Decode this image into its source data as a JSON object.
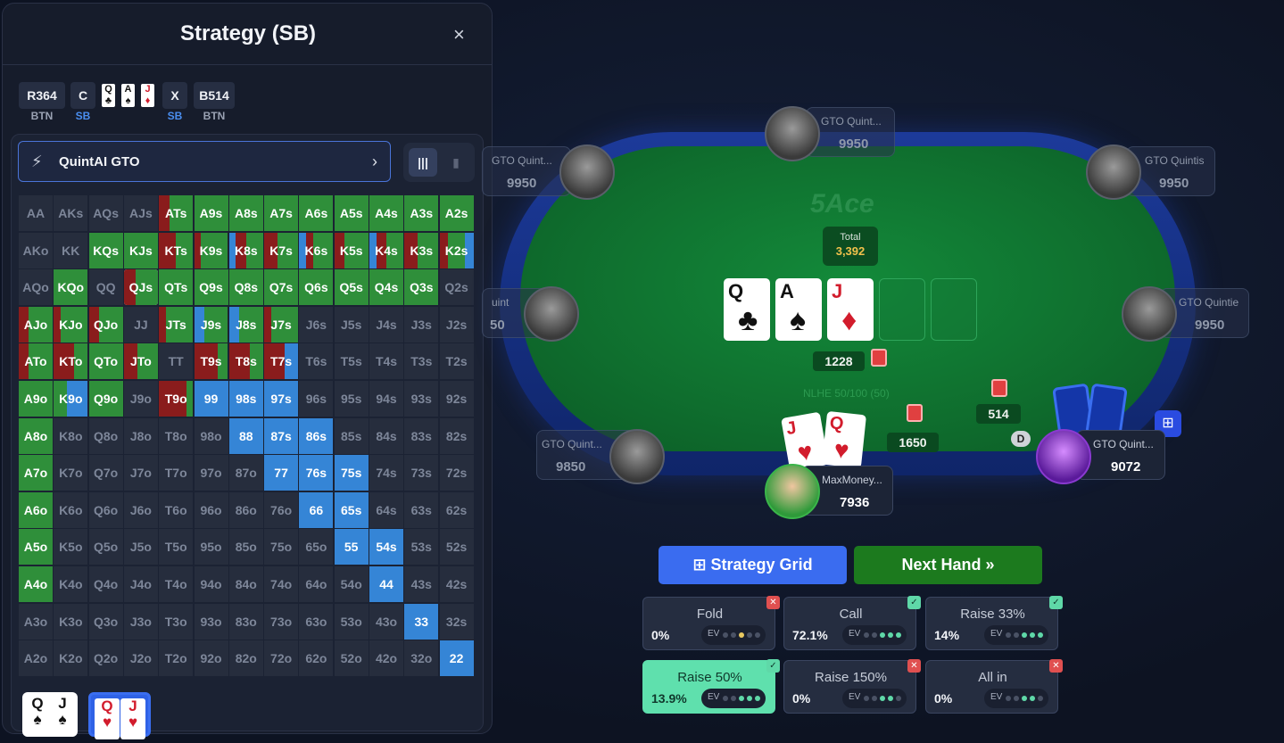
{
  "panel": {
    "title": "Strategy (SB)",
    "close": "×",
    "actions": [
      {
        "label": "R364",
        "sub": "BTN",
        "subColor": "#9aa2b3"
      },
      {
        "label": "C",
        "sub": "SB",
        "subColor": "#4a8ef0"
      },
      {
        "label": "X",
        "sub": "SB",
        "subColor": "#4a8ef0"
      },
      {
        "label": "B514",
        "sub": "BTN",
        "subColor": "#9aa2b3"
      }
    ],
    "history_cards": [
      {
        "rank": "Q",
        "suit": "♣",
        "color": "#111111"
      },
      {
        "rank": "A",
        "suit": "♠",
        "color": "#111111"
      },
      {
        "rank": "J",
        "suit": "♦",
        "color": "#d21c2c"
      }
    ],
    "engine": {
      "name": "QuintAI GTO",
      "bolt": "⚡",
      "chevron": "›"
    },
    "view_toggle": {
      "grid_icon": "|||",
      "bars_icon": "▮"
    },
    "combos": [
      {
        "r1": "Q",
        "s1": "♠",
        "r2": "J",
        "s2": "♠",
        "color": "#111111"
      },
      {
        "r1": "Q",
        "s1": "♥",
        "r2": "J",
        "s2": "♥",
        "color": "#d21c2c"
      }
    ]
  },
  "matrix": {
    "rows": [
      [
        "AA",
        "AKs",
        "AQs",
        "AJs",
        "ATs",
        "A9s",
        "A8s",
        "A7s",
        "A6s",
        "A5s",
        "A4s",
        "A3s",
        "A2s"
      ],
      [
        "AKo",
        "KK",
        "KQs",
        "KJs",
        "KTs",
        "K9s",
        "K8s",
        "K7s",
        "K6s",
        "K5s",
        "K4s",
        "K3s",
        "K2s"
      ],
      [
        "AQo",
        "KQo",
        "QQ",
        "QJs",
        "QTs",
        "Q9s",
        "Q8s",
        "Q7s",
        "Q6s",
        "Q5s",
        "Q4s",
        "Q3s",
        "Q2s"
      ],
      [
        "AJo",
        "KJo",
        "QJo",
        "JJ",
        "JTs",
        "J9s",
        "J8s",
        "J7s",
        "J6s",
        "J5s",
        "J4s",
        "J3s",
        "J2s"
      ],
      [
        "ATo",
        "KTo",
        "QTo",
        "JTo",
        "TT",
        "T9s",
        "T8s",
        "T7s",
        "T6s",
        "T5s",
        "T4s",
        "T3s",
        "T2s"
      ],
      [
        "A9o",
        "K9o",
        "Q9o",
        "J9o",
        "T9o",
        "99",
        "98s",
        "97s",
        "96s",
        "95s",
        "94s",
        "93s",
        "92s"
      ],
      [
        "A8o",
        "K8o",
        "Q8o",
        "J8o",
        "T8o",
        "98o",
        "88",
        "87s",
        "86s",
        "85s",
        "84s",
        "83s",
        "82s"
      ],
      [
        "A7o",
        "K7o",
        "Q7o",
        "J7o",
        "T7o",
        "97o",
        "87o",
        "77",
        "76s",
        "75s",
        "74s",
        "73s",
        "72s"
      ],
      [
        "A6o",
        "K6o",
        "Q6o",
        "J6o",
        "T6o",
        "96o",
        "86o",
        "76o",
        "66",
        "65s",
        "64s",
        "63s",
        "62s"
      ],
      [
        "A5o",
        "K5o",
        "Q5o",
        "J5o",
        "T5o",
        "95o",
        "85o",
        "75o",
        "65o",
        "55",
        "54s",
        "53s",
        "52s"
      ],
      [
        "A4o",
        "K4o",
        "Q4o",
        "J4o",
        "T4o",
        "94o",
        "84o",
        "74o",
        "64o",
        "54o",
        "44",
        "43s",
        "42s"
      ],
      [
        "A3o",
        "K3o",
        "Q3o",
        "J3o",
        "T3o",
        "93o",
        "83o",
        "73o",
        "63o",
        "53o",
        "43o",
        "33",
        "32s"
      ],
      [
        "A2o",
        "K2o",
        "Q2o",
        "J2o",
        "T2o",
        "92o",
        "82o",
        "72o",
        "62o",
        "52o",
        "42o",
        "32o",
        "22"
      ]
    ],
    "colors": {
      "green": "#2f8f3a",
      "red": "#8a1c1c",
      "blue": "#3585d6",
      "empty": "#262d3d"
    },
    "fills": {
      "ATs": [
        [
          "red",
          0.3
        ],
        [
          "green",
          0.7
        ]
      ],
      "A9s": [
        [
          "green",
          1
        ]
      ],
      "A8s": [
        [
          "green",
          1
        ]
      ],
      "A7s": [
        [
          "green",
          1
        ]
      ],
      "A6s": [
        [
          "green",
          1
        ]
      ],
      "A5s": [
        [
          "green",
          1
        ]
      ],
      "A4s": [
        [
          "green",
          1
        ]
      ],
      "A3s": [
        [
          "green",
          1
        ]
      ],
      "A2s": [
        [
          "green",
          1
        ]
      ],
      "KQs": [
        [
          "green",
          1
        ]
      ],
      "KJs": [
        [
          "green",
          1
        ]
      ],
      "KTs": [
        [
          "red",
          0.5
        ],
        [
          "green",
          0.5
        ]
      ],
      "K9s": [
        [
          "red",
          0.2
        ],
        [
          "green",
          0.8
        ]
      ],
      "K8s": [
        [
          "blue",
          0.2
        ],
        [
          "red",
          0.3
        ],
        [
          "green",
          0.5
        ]
      ],
      "K7s": [
        [
          "red",
          0.4
        ],
        [
          "green",
          0.6
        ]
      ],
      "K6s": [
        [
          "blue",
          0.2
        ],
        [
          "red",
          0.2
        ],
        [
          "green",
          0.6
        ]
      ],
      "K5s": [
        [
          "red",
          0.3
        ],
        [
          "green",
          0.7
        ]
      ],
      "K4s": [
        [
          "blue",
          0.2
        ],
        [
          "red",
          0.3
        ],
        [
          "green",
          0.5
        ]
      ],
      "K3s": [
        [
          "red",
          0.4
        ],
        [
          "green",
          0.6
        ]
      ],
      "K2s": [
        [
          "red",
          0.25
        ],
        [
          "green",
          0.5
        ],
        [
          "blue",
          0.25
        ]
      ],
      "KQo": [
        [
          "green",
          1
        ]
      ],
      "QJs": [
        [
          "red",
          0.35
        ],
        [
          "green",
          0.65
        ]
      ],
      "QTs": [
        [
          "green",
          1
        ]
      ],
      "Q9s": [
        [
          "green",
          1
        ]
      ],
      "Q8s": [
        [
          "green",
          1
        ]
      ],
      "Q7s": [
        [
          "green",
          1
        ]
      ],
      "Q6s": [
        [
          "green",
          1
        ]
      ],
      "Q5s": [
        [
          "green",
          1
        ]
      ],
      "Q4s": [
        [
          "green",
          1
        ]
      ],
      "Q3s": [
        [
          "green",
          1
        ]
      ],
      "AJo": [
        [
          "red",
          0.3
        ],
        [
          "green",
          0.7
        ]
      ],
      "KJo": [
        [
          "red",
          0.2
        ],
        [
          "green",
          0.8
        ]
      ],
      "QJo": [
        [
          "red",
          0.3
        ],
        [
          "green",
          0.7
        ]
      ],
      "JTs": [
        [
          "red",
          0.2
        ],
        [
          "green",
          0.8
        ]
      ],
      "J9s": [
        [
          "blue",
          0.3
        ],
        [
          "green",
          0.7
        ]
      ],
      "J8s": [
        [
          "blue",
          0.3
        ],
        [
          "green",
          0.7
        ]
      ],
      "J7s": [
        [
          "red",
          0.2
        ],
        [
          "green",
          0.8
        ]
      ],
      "ATo": [
        [
          "red",
          0.3
        ],
        [
          "green",
          0.7
        ]
      ],
      "KTo": [
        [
          "red",
          0.6
        ],
        [
          "green",
          0.4
        ]
      ],
      "QTo": [
        [
          "green",
          1
        ]
      ],
      "JTo": [
        [
          "red",
          0.4
        ],
        [
          "green",
          0.6
        ]
      ],
      "T9s": [
        [
          "red",
          0.7
        ],
        [
          "green",
          0.3
        ]
      ],
      "T8s": [
        [
          "red",
          0.6
        ],
        [
          "green",
          0.4
        ]
      ],
      "T7s": [
        [
          "red",
          0.6
        ],
        [
          "blue",
          0.4
        ]
      ],
      "A9o": [
        [
          "green",
          1
        ]
      ],
      "K9o": [
        [
          "green",
          0.4
        ],
        [
          "blue",
          0.6
        ]
      ],
      "Q9o": [
        [
          "green",
          1
        ]
      ],
      "T9o": [
        [
          "red",
          0.8
        ],
        [
          "green",
          0.2
        ]
      ],
      "99": [
        [
          "blue",
          1
        ]
      ],
      "98s": [
        [
          "blue",
          1
        ]
      ],
      "97s": [
        [
          "blue",
          1
        ]
      ],
      "A8o": [
        [
          "green",
          1
        ]
      ],
      "88": [
        [
          "blue",
          1
        ]
      ],
      "87s": [
        [
          "blue",
          1
        ]
      ],
      "86s": [
        [
          "blue",
          1
        ]
      ],
      "A7o": [
        [
          "green",
          1
        ]
      ],
      "77": [
        [
          "blue",
          1
        ]
      ],
      "76s": [
        [
          "blue",
          1
        ]
      ],
      "75s": [
        [
          "blue",
          1
        ]
      ],
      "A6o": [
        [
          "green",
          1
        ]
      ],
      "66": [
        [
          "blue",
          1
        ]
      ],
      "65s": [
        [
          "blue",
          1
        ]
      ],
      "A5o": [
        [
          "green",
          1
        ]
      ],
      "55": [
        [
          "blue",
          1
        ]
      ],
      "54s": [
        [
          "blue",
          1
        ]
      ],
      "A4o": [
        [
          "green",
          1
        ]
      ],
      "44": [
        [
          "blue",
          1
        ]
      ],
      "33": [
        [
          "blue",
          1
        ]
      ],
      "22": [
        [
          "blue",
          1
        ]
      ]
    },
    "selected": "QJs"
  },
  "table": {
    "logo": "5Ace",
    "pot_label": "Total",
    "pot_value": "3,392",
    "board": [
      {
        "rank": "Q",
        "suit": "♣",
        "color": "#111111"
      },
      {
        "rank": "A",
        "suit": "♠",
        "color": "#111111"
      },
      {
        "rank": "J",
        "suit": "♦",
        "color": "#d21c2c"
      }
    ],
    "street_amount": "1228",
    "blinds": "NLHE 50/100 (50)",
    "hero_bet": "1650",
    "villain_bet": "514",
    "dealer": "D",
    "hero_cards": [
      {
        "rank": "J",
        "suit": "♥"
      },
      {
        "rank": "Q",
        "suit": "♥"
      }
    ],
    "grid_icon": "⊞"
  },
  "seats": [
    {
      "name": "GTO Quint...",
      "stack": "9950"
    },
    {
      "name": "GTO Quint...",
      "stack": "9950"
    },
    {
      "name": "GTO Quintis",
      "stack": "9950"
    },
    {
      "name": "uint",
      "stack": "50"
    },
    {
      "name": "GTO Quintie",
      "stack": "9950"
    },
    {
      "name": "GTO Quint...",
      "stack": "9850"
    },
    {
      "name": "MaxMoney...",
      "stack": "7936"
    },
    {
      "name": "GTO Quint...",
      "stack": "9072"
    }
  ],
  "controls": {
    "strategy_grid": "Strategy Grid",
    "strategy_icon": "⊞",
    "next_hand": "Next Hand",
    "next_icon": "»"
  },
  "options": [
    {
      "label": "Fold",
      "pct": "0%",
      "badge": "x",
      "ev": [
        0,
        0,
        2,
        0,
        0
      ]
    },
    {
      "label": "Call",
      "pct": "72.1%",
      "badge": "ok",
      "ev": [
        0,
        0,
        1,
        1,
        1
      ]
    },
    {
      "label": "Raise 33%",
      "pct": "14%",
      "badge": "ok",
      "ev": [
        0,
        0,
        1,
        1,
        1
      ]
    },
    {
      "label": "Raise 50%",
      "pct": "13.9%",
      "badge": "ok",
      "ev": [
        0,
        0,
        1,
        1,
        1
      ]
    },
    {
      "label": "Raise 150%",
      "pct": "0%",
      "badge": "x",
      "ev": [
        0,
        0,
        1,
        1,
        0
      ]
    },
    {
      "label": "All in",
      "pct": "0%",
      "badge": "x",
      "ev": [
        0,
        0,
        1,
        1,
        0
      ]
    }
  ],
  "ev_label": "EV",
  "ev_colors": {
    "off": "#4a5265",
    "on": "#5fd8a8",
    "warn": "#e8c860"
  },
  "badge_glyphs": {
    "x": "✕",
    "ok": "✓"
  }
}
